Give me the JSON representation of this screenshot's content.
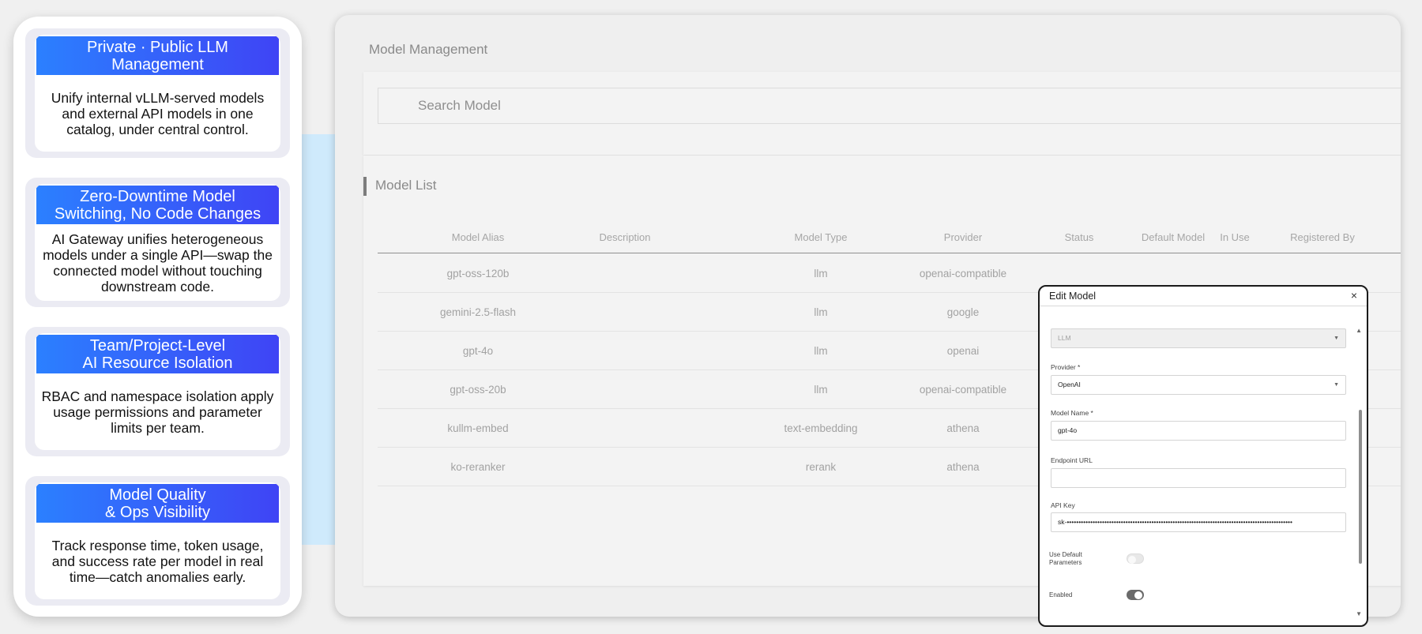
{
  "features": [
    {
      "title": "Private · Public LLM\nManagement",
      "body": "Unify internal vLLM-served models and external API models in one catalog, under central control."
    },
    {
      "title": "Zero-Downtime Model\nSwitching, No Code Changes",
      "body": "AI Gateway unifies heterogeneous models under a single API—swap the connected model without touching downstream code."
    },
    {
      "title": "Team/Project-Level\nAI Resource Isolation",
      "body": "RBAC and namespace isolation apply usage permissions and parameter limits per team."
    },
    {
      "title": "Model Quality\n& Ops Visibility",
      "body": "Track response time, token usage, and success rate per model in real time—catch anomalies early."
    }
  ],
  "app": {
    "page_title": "Model Management",
    "search_placeholder": "Search Model",
    "list_title": "Model List"
  },
  "table": {
    "columns": [
      "Model Alias",
      "Description",
      "Model Type",
      "Provider",
      "Status",
      "Default Model",
      "In Use",
      "Registered By"
    ],
    "rows": [
      {
        "alias": "gpt-oss-120b",
        "type": "llm",
        "provider": "openai-compatible"
      },
      {
        "alias": "gemini-2.5-flash",
        "type": "llm",
        "provider": "google"
      },
      {
        "alias": "gpt-4o",
        "type": "llm",
        "provider": "openai"
      },
      {
        "alias": "gpt-oss-20b",
        "type": "llm",
        "provider": "openai-compatible"
      },
      {
        "alias": "kullm-embed",
        "type": "text-embedding",
        "provider": "athena"
      },
      {
        "alias": "ko-reranker",
        "type": "rerank",
        "provider": "athena"
      }
    ]
  },
  "dialog": {
    "title": "Edit Model",
    "close_glyph": "×",
    "model_type_value": "LLM",
    "provider_label": "Provider *",
    "provider_value": "OpenAI",
    "model_name_label": "Model Name *",
    "model_name_value": "gpt-4o",
    "endpoint_label": "Endpoint URL",
    "endpoint_value": "",
    "api_key_label": "API Key",
    "api_key_value": "sk-••••••••••••••••••••••••••••••••••••••••••••••••••••••••••••••••••••••••••••••••••••••••••••••••",
    "use_default_label": "Use Default\nParameters",
    "use_default_on": false,
    "enabled_label": "Enabled",
    "enabled_on": true
  }
}
